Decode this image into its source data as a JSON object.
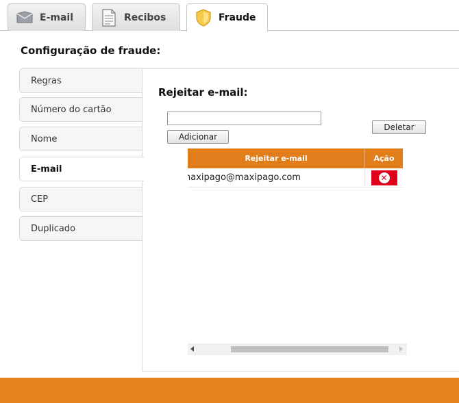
{
  "tabs": [
    {
      "label": "E-mail",
      "icon": "envelope-icon",
      "active": false
    },
    {
      "label": "Recibos",
      "icon": "document-icon",
      "active": false
    },
    {
      "label": "Fraude",
      "icon": "shield-icon",
      "active": true
    }
  ],
  "page_title": "Configuração de fraude:",
  "side_menu": {
    "items": [
      {
        "label": "Regras"
      },
      {
        "label": "Número do cartão"
      },
      {
        "label": "Nome"
      },
      {
        "label": "E-mail",
        "active": true
      },
      {
        "label": "CEP"
      },
      {
        "label": "Duplicado"
      }
    ]
  },
  "panel": {
    "title": "Rejeitar e-mail:",
    "input": {
      "value": "",
      "placeholder": ""
    },
    "add_label": "Adicionar",
    "delete_label": "Deletar",
    "table": {
      "columns": [
        "Rejeitar e-mail",
        "Ação"
      ],
      "rows": [
        {
          "email": "naxipago@maxipago.com",
          "action_icon": "delete-icon"
        }
      ]
    }
  },
  "colors": {
    "accent": "#e5831f",
    "table_header": "#e27d1c",
    "delete_red": "#e1001b"
  }
}
